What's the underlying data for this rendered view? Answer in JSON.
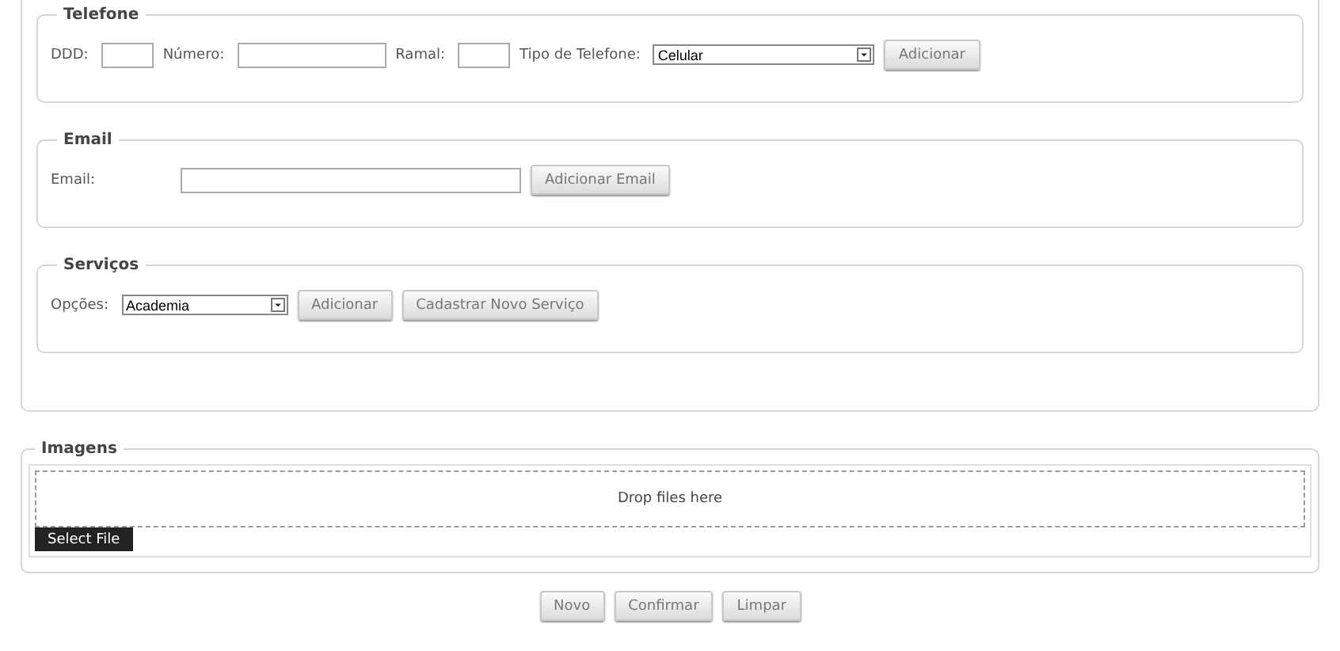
{
  "groups": [
    {
      "legend": "Telefone",
      "items": [
        {
          "kind": "label",
          "text": "DDD:"
        },
        {
          "kind": "small-field"
        },
        {
          "kind": "label",
          "text": "Número:"
        },
        {
          "kind": "field"
        },
        {
          "kind": "label",
          "text": "Ramal:"
        },
        {
          "kind": "small-field"
        },
        {
          "kind": "label",
          "text": "Tipo de Telefone:"
        },
        {
          "kind": "wide-select",
          "value": "Celular"
        },
        {
          "kind": "button",
          "text": "Adicionar"
        }
      ]
    },
    {
      "legend": "Email",
      "items": [
        {
          "kind": "wide-label",
          "text": "Email:"
        },
        {
          "kind": "wide-field"
        },
        {
          "kind": "button",
          "text": "Adicionar Email"
        }
      ]
    },
    {
      "legend": "Serviços",
      "items": [
        {
          "kind": "label",
          "text": "Opções:"
        },
        {
          "kind": "select",
          "value": "Academia"
        },
        {
          "kind": "button",
          "text": "Adicionar"
        },
        {
          "kind": "button",
          "text": "Cadastrar Novo Serviço"
        }
      ]
    }
  ],
  "images": {
    "legend": "Imagens",
    "dropzone": "Drop files here",
    "select_button": "Select File"
  },
  "actions": [
    "Novo",
    "Confirmar",
    "Limpar"
  ]
}
